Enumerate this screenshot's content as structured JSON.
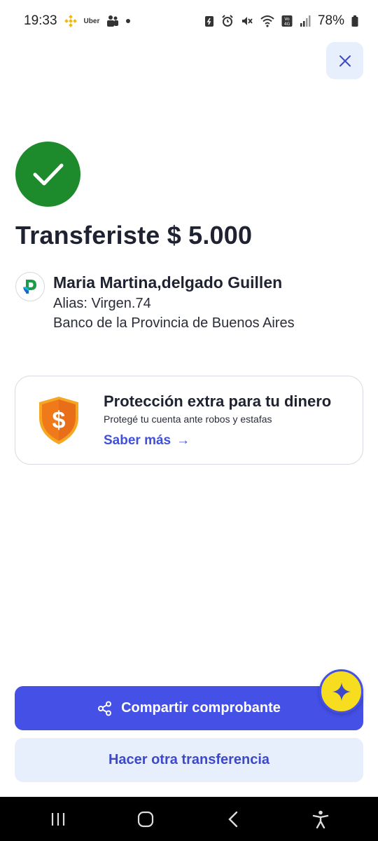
{
  "status_bar": {
    "time": "19:33",
    "uber_label": "Uber",
    "battery": "78%"
  },
  "header": {
    "close_label": "×"
  },
  "result": {
    "title": "Transferiste $ 5.000"
  },
  "recipient": {
    "name": "Maria Martina,delgado Guillen",
    "alias": "Alias: Virgen.74",
    "bank": "Banco de la Provincia de Buenos Aires"
  },
  "protection_card": {
    "title": "Protección extra para tu dinero",
    "subtitle": "Protegé tu cuenta ante robos y estafas",
    "link_label": "Saber más",
    "link_arrow": "→"
  },
  "actions": {
    "share_label": "Compartir comprobante",
    "another_label": "Hacer otra transferencia"
  },
  "colors": {
    "primary": "#4550e6",
    "success": "#1d8a2c",
    "secondary_bg": "#e7eefc",
    "link": "#4150d8",
    "ai_fab": "#f6dd1f"
  },
  "icons": {
    "close": "close-icon",
    "success": "check-icon",
    "bank": "bank-logo-icon",
    "shield": "shield-dollar-icon",
    "share": "share-icon",
    "ai": "sparkle-icon"
  }
}
